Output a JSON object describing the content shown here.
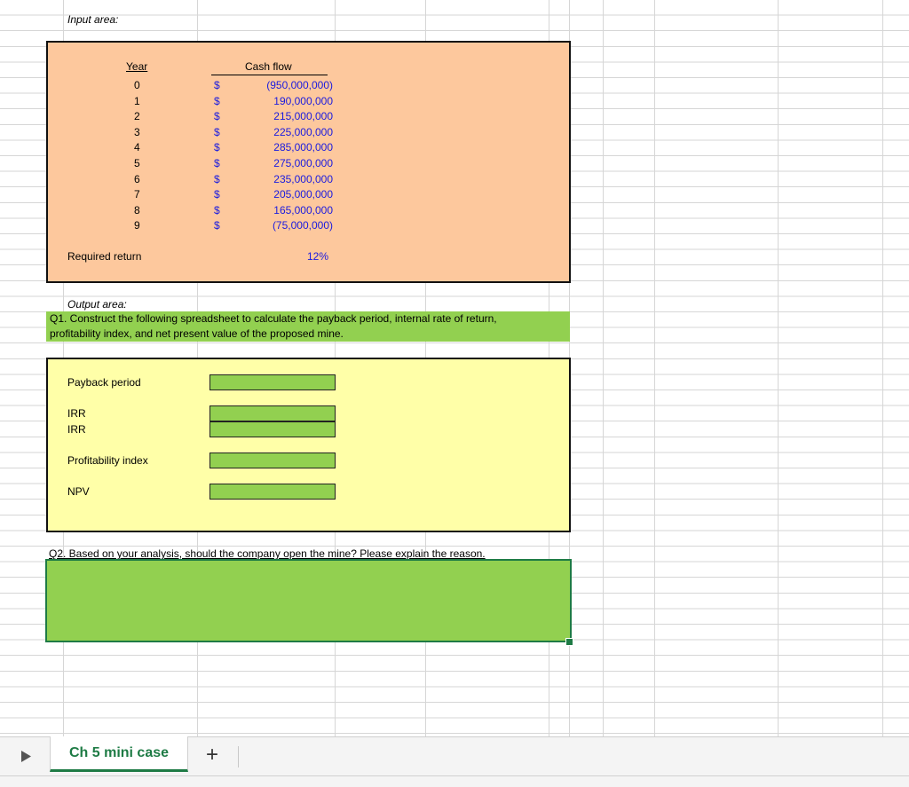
{
  "input_area": {
    "label": "Input area:",
    "year_header": "Year",
    "cash_flow_header": "Cash flow",
    "currency_symbol": "$",
    "rows": [
      {
        "year": "0",
        "cash_flow": "(950,000,000)"
      },
      {
        "year": "1",
        "cash_flow": "190,000,000"
      },
      {
        "year": "2",
        "cash_flow": "215,000,000"
      },
      {
        "year": "3",
        "cash_flow": "225,000,000"
      },
      {
        "year": "4",
        "cash_flow": "285,000,000"
      },
      {
        "year": "5",
        "cash_flow": "275,000,000"
      },
      {
        "year": "6",
        "cash_flow": "235,000,000"
      },
      {
        "year": "7",
        "cash_flow": "205,000,000"
      },
      {
        "year": "8",
        "cash_flow": "165,000,000"
      },
      {
        "year": "9",
        "cash_flow": "(75,000,000)"
      }
    ],
    "required_return_label": "Required return",
    "required_return_value": "12%"
  },
  "output_area": {
    "label": "Output area:",
    "q1_line1": "Q1. Construct the following spreadsheet to calculate the payback period, internal rate of return,",
    "q1_line2": "profitability index, and net present value of the proposed mine.",
    "payback_label": "Payback period",
    "irr_label_1": "IRR",
    "irr_label_2": "IRR",
    "pi_label": "Profitability index",
    "npv_label": "NPV"
  },
  "q2": {
    "text": "Q2. Based on your analysis, should the company open the mine? Please explain the reason."
  },
  "tabs": {
    "play_icon": "play-icon",
    "active_sheet": "Ch 5 mini case",
    "add_sheet": "+"
  },
  "colors": {
    "input_fill": "#fdc89d",
    "output_fill": "#ffffa8",
    "green_fill": "#92d050",
    "input_text_blue": "#1a1adf",
    "accent_green": "#1e7b45"
  }
}
